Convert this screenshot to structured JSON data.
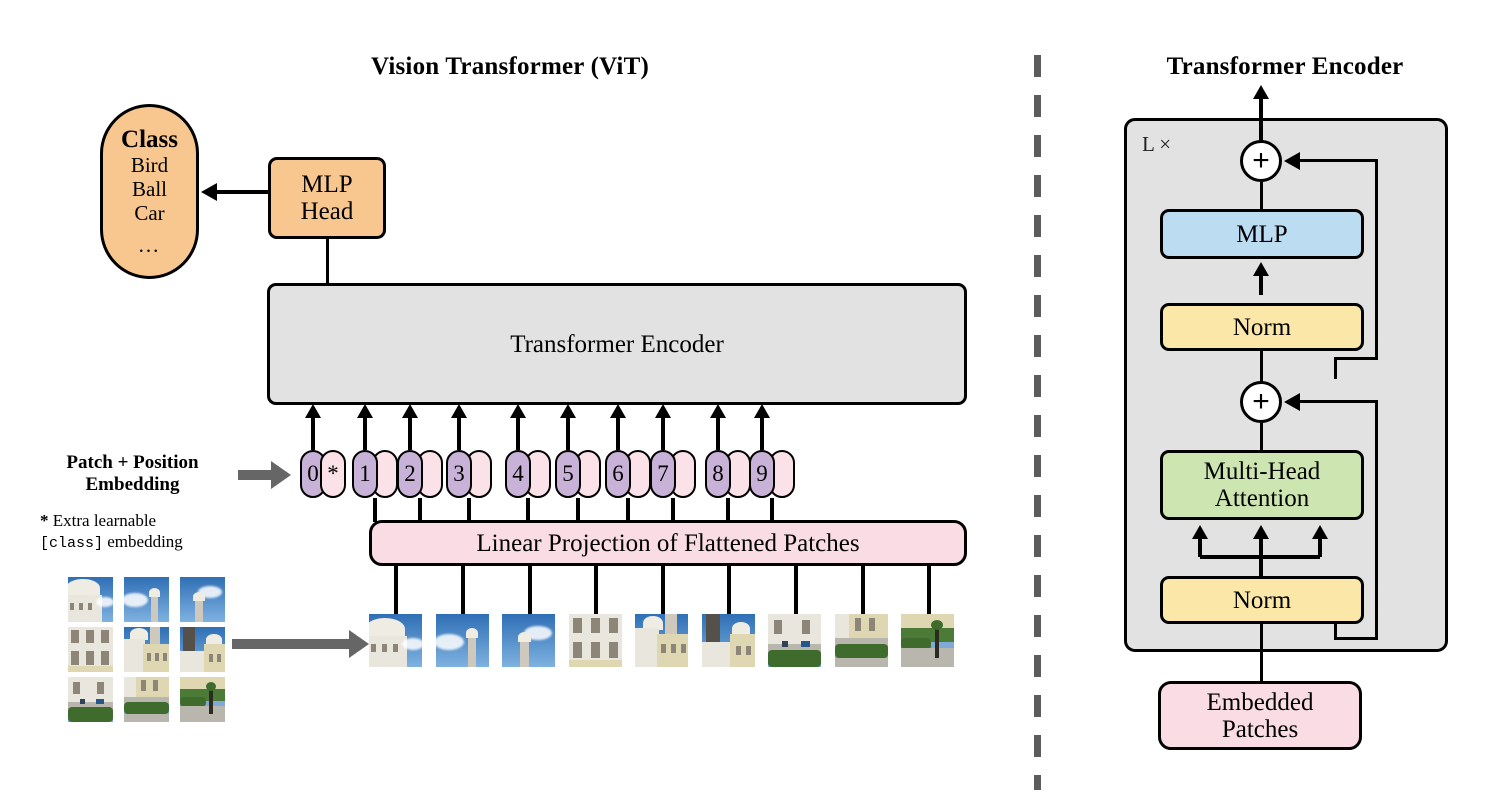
{
  "figure": {
    "left_title": "Vision Transformer (ViT)",
    "right_title": "Transformer Encoder"
  },
  "left_panel": {
    "class_head": "Class",
    "class_items": [
      "Bird",
      "Ball",
      "Car"
    ],
    "class_ellipsis": "...",
    "mlp_head_line1": "MLP",
    "mlp_head_line2": "Head",
    "encoder_label": "Transformer Encoder",
    "linear_projection_label": "Linear Projection of Flattened Patches",
    "patch_position_label_line1": "Patch + Position",
    "patch_position_label_line2": "Embedding",
    "extra_note_marker": "*",
    "extra_note_line1": "Extra learnable",
    "extra_note_mono": "[class]",
    "extra_note_line2": "embedding",
    "tokens": [
      {
        "num": "0",
        "pos": "*"
      },
      {
        "num": "1",
        "pos": ""
      },
      {
        "num": "2",
        "pos": ""
      },
      {
        "num": "3",
        "pos": ""
      },
      {
        "num": "4",
        "pos": ""
      },
      {
        "num": "5",
        "pos": ""
      },
      {
        "num": "6",
        "pos": ""
      },
      {
        "num": "7",
        "pos": ""
      },
      {
        "num": "8",
        "pos": ""
      },
      {
        "num": "9",
        "pos": ""
      }
    ],
    "patch_count": 9,
    "source_grid": "3x3"
  },
  "right_panel": {
    "repeat_label": "L ×",
    "mlp_label": "MLP",
    "norm_top_label": "Norm",
    "mha_line1": "Multi-Head",
    "mha_line2": "Attention",
    "norm_bottom_label": "Norm",
    "embedded_line1": "Embedded",
    "embedded_line2": "Patches",
    "residual_add_symbol": "+"
  },
  "colors": {
    "orange": "#f8c68f",
    "gray": "#e2e2e2",
    "pink": "#fadde4",
    "blue": "#bcdcf2",
    "yellow": "#fbe8a8",
    "green": "#cde6b1",
    "token_number": "#c9b2d7",
    "token_position": "#fbe1e8",
    "divider": "#5c5c5c",
    "gray_arrow": "#666666",
    "outline": "#000000"
  }
}
